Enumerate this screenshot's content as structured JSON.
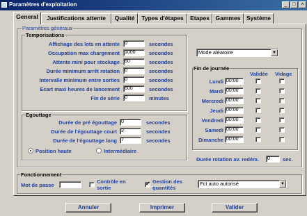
{
  "window": {
    "title": "Paramètres d'exploitation",
    "controls": [
      "_",
      "□",
      "×"
    ]
  },
  "tabs": [
    "General",
    "Justifications attente",
    "Qualité",
    "Types d'étapes",
    "Etapes",
    "Gammes",
    "Système"
  ],
  "general": {
    "title": "Paramètres généraux",
    "temporisations": {
      "title": "Temporisations",
      "rows": [
        {
          "label": "Affichage des lots en attente",
          "value": "0",
          "unit": "secondes"
        },
        {
          "label": "Occupation max chargement",
          "value": "1000",
          "unit": "secondes"
        },
        {
          "label": "Attente mini pour stockage",
          "value": "60",
          "unit": "secondes"
        },
        {
          "label": "Durée minimum arrêt rotation",
          "value": "0",
          "unit": "secondes"
        },
        {
          "label": "Intervalle minimum entre sorties",
          "value": "0",
          "unit": "secondes"
        },
        {
          "label": "Ecart maxi heures de lancement",
          "value": "600",
          "unit": "secondes"
        },
        {
          "label": "Fin de série",
          "value": "0",
          "unit": "minutes"
        }
      ]
    },
    "mode": "Mode aléatoire",
    "fin_journee": {
      "title": "Fin de journée",
      "col_validee": "Validée",
      "col_vidage": "Vidage",
      "days": [
        {
          "label": "Lundi",
          "time": "00:00"
        },
        {
          "label": "Mardi",
          "time": "00:00"
        },
        {
          "label": "Mercredi",
          "time": "00:00"
        },
        {
          "label": "Jeudi",
          "time": "00:00"
        },
        {
          "label": "Vendredi",
          "time": "00:00"
        },
        {
          "label": "Samedi",
          "time": "00:00"
        },
        {
          "label": "Dimanche",
          "time": "00:00"
        }
      ]
    },
    "egouttage": {
      "title": "Egouttage",
      "rows": [
        {
          "label": "Durée de pré égouttage",
          "value": "0",
          "unit": "secondes"
        },
        {
          "label": "Durée de l'égouttage court",
          "value": "3",
          "unit": "secondes"
        },
        {
          "label": "Durée de l'égouttage long",
          "value": "7",
          "unit": "secondes"
        }
      ],
      "radio_haute": "Position haute",
      "radio_intermediaire": "Intermédiaire"
    },
    "rotation": {
      "label": "Durée rotation av. redém.",
      "value": "0",
      "unit": "sec."
    },
    "fonctionnement": {
      "title": "Fonctionnement",
      "password_label": "Mot de passe",
      "password_value": "",
      "controle_label_1": "Contrôle en",
      "controle_label_2": "sortie",
      "gestion_label_1": "Gestion des",
      "gestion_label_2": "quantités",
      "fct_value": "Fct auto autorisé"
    }
  },
  "footer": {
    "cancel": "Annuler",
    "print": "Imprimer",
    "validate": "Valider"
  }
}
